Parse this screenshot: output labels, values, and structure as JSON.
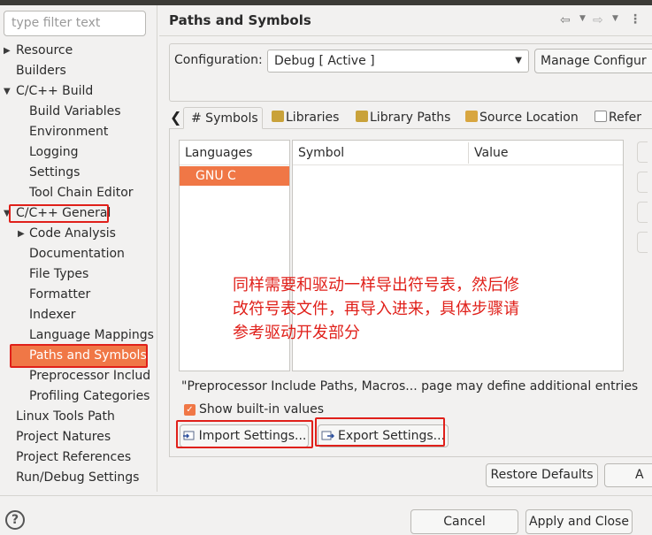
{
  "filter": {
    "placeholder": "type filter text"
  },
  "tree": [
    {
      "label": "Resource",
      "indent": 0,
      "arrow": "▶"
    },
    {
      "label": "Builders",
      "indent": 0,
      "arrow": ""
    },
    {
      "label": "C/C++ Build",
      "indent": 0,
      "arrow": "▼"
    },
    {
      "label": "Build Variables",
      "indent": 1,
      "arrow": ""
    },
    {
      "label": "Environment",
      "indent": 1,
      "arrow": ""
    },
    {
      "label": "Logging",
      "indent": 1,
      "arrow": ""
    },
    {
      "label": "Settings",
      "indent": 1,
      "arrow": ""
    },
    {
      "label": "Tool Chain Editor",
      "indent": 1,
      "arrow": ""
    },
    {
      "label": "C/C++ General",
      "indent": 0,
      "arrow": "▼"
    },
    {
      "label": "Code Analysis",
      "indent": 1,
      "arrow": "▶"
    },
    {
      "label": "Documentation",
      "indent": 1,
      "arrow": ""
    },
    {
      "label": "File Types",
      "indent": 1,
      "arrow": ""
    },
    {
      "label": "Formatter",
      "indent": 1,
      "arrow": ""
    },
    {
      "label": "Indexer",
      "indent": 1,
      "arrow": ""
    },
    {
      "label": "Language Mappings",
      "indent": 1,
      "arrow": ""
    },
    {
      "label": "Paths and Symbols",
      "indent": 1,
      "arrow": "",
      "selected": true
    },
    {
      "label": "Preprocessor Includ",
      "indent": 1,
      "arrow": ""
    },
    {
      "label": "Profiling Categories",
      "indent": 1,
      "arrow": ""
    },
    {
      "label": "Linux Tools Path",
      "indent": 0,
      "arrow": ""
    },
    {
      "label": "Project Natures",
      "indent": 0,
      "arrow": ""
    },
    {
      "label": "Project References",
      "indent": 0,
      "arrow": ""
    },
    {
      "label": "Run/Debug Settings",
      "indent": 0,
      "arrow": ""
    }
  ],
  "page": {
    "title": "Paths and Symbols"
  },
  "config": {
    "label": "Configuration:",
    "value": "Debug  [ Active ]",
    "manage_label": "Manage Configur"
  },
  "tabs": [
    {
      "label": "# Symbols",
      "active": true
    },
    {
      "label": "Libraries",
      "icon_color": "#c9a23a"
    },
    {
      "label": "Library Paths",
      "icon_color": "#c9a23a"
    },
    {
      "label": "Source Location",
      "icon_color": "#d8a640"
    },
    {
      "label": "Refer",
      "icon_color": "#8c8c8c"
    }
  ],
  "languages": {
    "header": "Languages",
    "items": [
      "GNU C"
    ]
  },
  "symbols_table": {
    "col_symbol": "Symbol",
    "col_value": "Value"
  },
  "annotation": {
    "line1": "同样需要和驱动一样导出符号表，然后修",
    "line2": "改符号表文件，再导入进来，具体步骤请",
    "line3": "参考驱动开发部分"
  },
  "note": "\"Preprocessor Include Paths, Macros... page may define additional entries",
  "show_builtin": {
    "label": "Show built-in values",
    "checked": true
  },
  "buttons": {
    "import": "Import Settings...",
    "export": "Export Settings...",
    "restore": "Restore Defaults",
    "apply_stub": "A",
    "cancel": "Cancel",
    "apply_close": "Apply and Close"
  },
  "help": "?",
  "colors": {
    "selection": "#f07746",
    "highlight_box": "#e0201a"
  }
}
